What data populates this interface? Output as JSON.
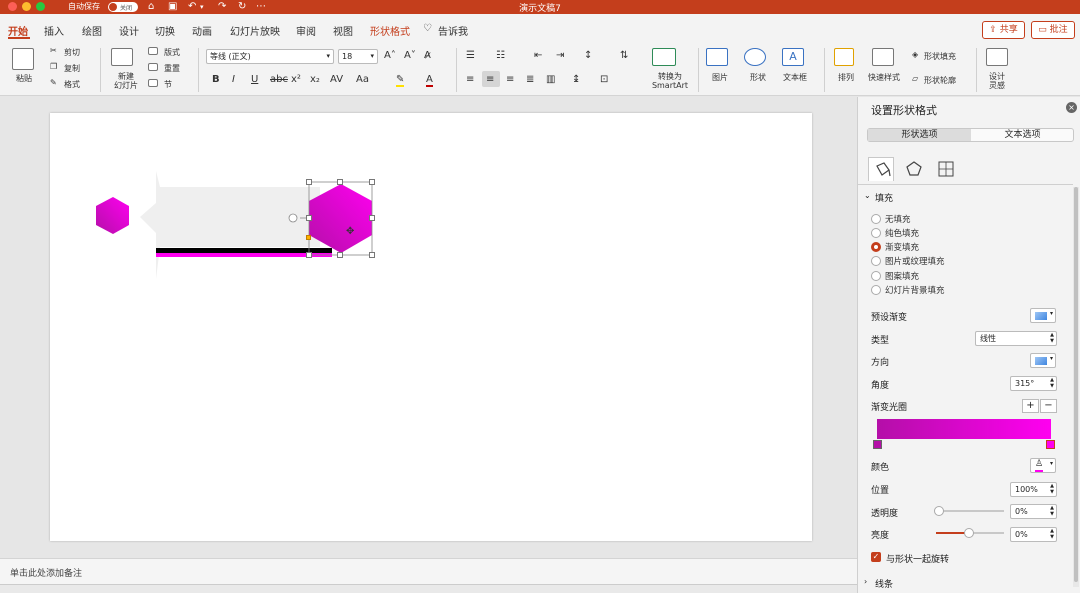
{
  "titlebar": {
    "autosave_label": "自动保存",
    "autosave_state": "关闭",
    "doc_title": "演示文稿7"
  },
  "tabs": [
    {
      "label": "开始",
      "active": true
    },
    {
      "label": "插入"
    },
    {
      "label": "绘图"
    },
    {
      "label": "设计"
    },
    {
      "label": "切换"
    },
    {
      "label": "动画"
    },
    {
      "label": "幻灯片放映"
    },
    {
      "label": "审阅"
    },
    {
      "label": "视图"
    },
    {
      "label": "形状格式",
      "highlight": true
    },
    {
      "label": "告诉我"
    }
  ],
  "actions": {
    "share": "共享",
    "comments": "批注"
  },
  "ribbon": {
    "paste": "粘贴",
    "cut": "剪切",
    "copy": "复制",
    "format": "格式",
    "new_slide": "新建\n幻灯片",
    "layout": "版式",
    "reset": "重置",
    "section": "节",
    "font_name": "等线 (正文)",
    "font_size": "18",
    "convert_smartart": "转换为\nSmartArt",
    "picture": "图片",
    "shape": "形状",
    "textbox": "文本框",
    "arrange": "排列",
    "quick_styles": "快速样式",
    "shape_fill": "形状填充",
    "shape_outline": "形状轮廓",
    "design_ideas": "设计\n灵感"
  },
  "notes_placeholder": "单击此处添加备注",
  "pane": {
    "title": "设置形状格式",
    "tab_shape": "形状选项",
    "tab_text": "文本选项",
    "fill_section": "填充",
    "fill_options": [
      {
        "label": "无填充",
        "selected": false
      },
      {
        "label": "纯色填充",
        "selected": false
      },
      {
        "label": "渐变填充",
        "selected": true
      },
      {
        "label": "图片或纹理填充",
        "selected": false
      },
      {
        "label": "图案填充",
        "selected": false
      },
      {
        "label": "幻灯片背景填充",
        "selected": false
      }
    ],
    "preset_gradient": "预设渐变",
    "type_label": "类型",
    "type_value": "线性",
    "direction_label": "方向",
    "angle_label": "角度",
    "angle_value": "315°",
    "stops_label": "渐变光圈",
    "color_label": "颜色",
    "position_label": "位置",
    "position_value": "100%",
    "transparency_label": "透明度",
    "transparency_value": "0%",
    "brightness_label": "亮度",
    "brightness_value": "0%",
    "rotate_with_shape": "与形状一起旋转",
    "line_section": "线条",
    "gradient_start": "#b40fa8",
    "gradient_end": "#ff00f0"
  },
  "colors": {
    "accent": "#c43e1c",
    "magenta": "#ff00f0"
  }
}
